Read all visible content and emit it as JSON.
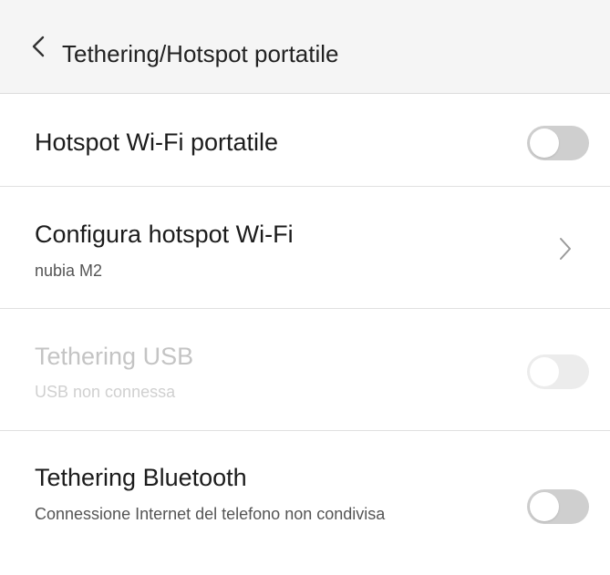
{
  "header": {
    "title": "Tethering/Hotspot portatile"
  },
  "settings": [
    {
      "title": "Hotspot Wi-Fi portatile",
      "toggle_on": false
    },
    {
      "title": "Configura hotspot Wi-Fi",
      "subtitle": "nubia M2"
    },
    {
      "title": "Tethering USB",
      "subtitle": "USB non connessa",
      "toggle_on": false,
      "enabled": false
    },
    {
      "title": "Tethering Bluetooth",
      "subtitle": "Connessione Internet del telefono non condivisa",
      "toggle_on": false
    }
  ],
  "colors": {
    "header_bg": "#f5f5f5",
    "toggle_off": "#cfcfcf",
    "toggle_disabled": "#ececec",
    "text_primary": "#1c1c1c",
    "text_disabled": "#c4c4c4"
  },
  "icons": {
    "back": "chevron-left-icon",
    "navigate": "chevron-right-icon"
  }
}
